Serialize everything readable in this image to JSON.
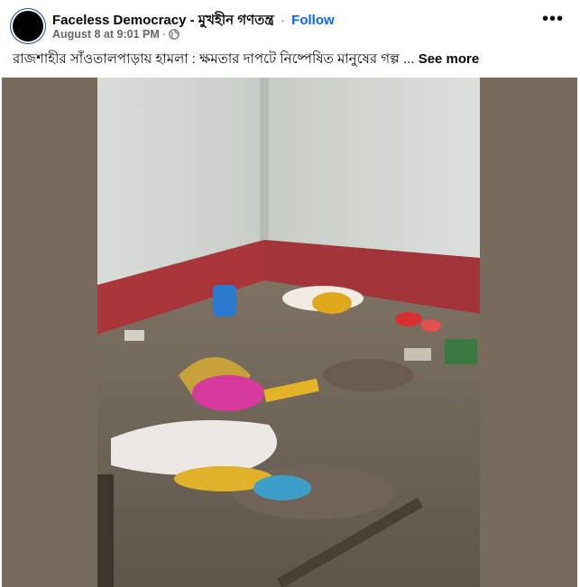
{
  "post": {
    "page_name": "Faceless Democracy - মুখহীন গণতন্ত্র",
    "separator": "·",
    "follow_label": "Follow",
    "timestamp": "August 8 at 9:01 PM",
    "meta_separator": "·",
    "audience_icon": "globe-icon",
    "more_icon": "more-options-icon",
    "more_label": "•••",
    "caption": "রাজশাহীর সাঁওতালপাড়ায় হামলা : ক্ষমতার দাপটে নিষ্পেষিত মানুষের গল্প ...",
    "see_more_label": "See more"
  },
  "colors": {
    "accent": "#0866ff",
    "secondary_text": "#65676b",
    "media_background": "#776b5d"
  }
}
